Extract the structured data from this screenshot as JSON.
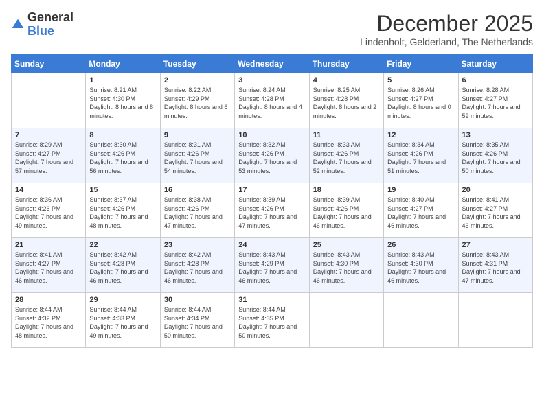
{
  "logo": {
    "general": "General",
    "blue": "Blue"
  },
  "title": "December 2025",
  "location": "Lindenholt, Gelderland, The Netherlands",
  "days_of_week": [
    "Sunday",
    "Monday",
    "Tuesday",
    "Wednesday",
    "Thursday",
    "Friday",
    "Saturday"
  ],
  "weeks": [
    [
      {
        "day": "",
        "sunrise": "",
        "sunset": "",
        "daylight": ""
      },
      {
        "day": "1",
        "sunrise": "Sunrise: 8:21 AM",
        "sunset": "Sunset: 4:30 PM",
        "daylight": "Daylight: 8 hours and 8 minutes."
      },
      {
        "day": "2",
        "sunrise": "Sunrise: 8:22 AM",
        "sunset": "Sunset: 4:29 PM",
        "daylight": "Daylight: 8 hours and 6 minutes."
      },
      {
        "day": "3",
        "sunrise": "Sunrise: 8:24 AM",
        "sunset": "Sunset: 4:28 PM",
        "daylight": "Daylight: 8 hours and 4 minutes."
      },
      {
        "day": "4",
        "sunrise": "Sunrise: 8:25 AM",
        "sunset": "Sunset: 4:28 PM",
        "daylight": "Daylight: 8 hours and 2 minutes."
      },
      {
        "day": "5",
        "sunrise": "Sunrise: 8:26 AM",
        "sunset": "Sunset: 4:27 PM",
        "daylight": "Daylight: 8 hours and 0 minutes."
      },
      {
        "day": "6",
        "sunrise": "Sunrise: 8:28 AM",
        "sunset": "Sunset: 4:27 PM",
        "daylight": "Daylight: 7 hours and 59 minutes."
      }
    ],
    [
      {
        "day": "7",
        "sunrise": "Sunrise: 8:29 AM",
        "sunset": "Sunset: 4:27 PM",
        "daylight": "Daylight: 7 hours and 57 minutes."
      },
      {
        "day": "8",
        "sunrise": "Sunrise: 8:30 AM",
        "sunset": "Sunset: 4:26 PM",
        "daylight": "Daylight: 7 hours and 56 minutes."
      },
      {
        "day": "9",
        "sunrise": "Sunrise: 8:31 AM",
        "sunset": "Sunset: 4:26 PM",
        "daylight": "Daylight: 7 hours and 54 minutes."
      },
      {
        "day": "10",
        "sunrise": "Sunrise: 8:32 AM",
        "sunset": "Sunset: 4:26 PM",
        "daylight": "Daylight: 7 hours and 53 minutes."
      },
      {
        "day": "11",
        "sunrise": "Sunrise: 8:33 AM",
        "sunset": "Sunset: 4:26 PM",
        "daylight": "Daylight: 7 hours and 52 minutes."
      },
      {
        "day": "12",
        "sunrise": "Sunrise: 8:34 AM",
        "sunset": "Sunset: 4:26 PM",
        "daylight": "Daylight: 7 hours and 51 minutes."
      },
      {
        "day": "13",
        "sunrise": "Sunrise: 8:35 AM",
        "sunset": "Sunset: 4:26 PM",
        "daylight": "Daylight: 7 hours and 50 minutes."
      }
    ],
    [
      {
        "day": "14",
        "sunrise": "Sunrise: 8:36 AM",
        "sunset": "Sunset: 4:26 PM",
        "daylight": "Daylight: 7 hours and 49 minutes."
      },
      {
        "day": "15",
        "sunrise": "Sunrise: 8:37 AM",
        "sunset": "Sunset: 4:26 PM",
        "daylight": "Daylight: 7 hours and 48 minutes."
      },
      {
        "day": "16",
        "sunrise": "Sunrise: 8:38 AM",
        "sunset": "Sunset: 4:26 PM",
        "daylight": "Daylight: 7 hours and 47 minutes."
      },
      {
        "day": "17",
        "sunrise": "Sunrise: 8:39 AM",
        "sunset": "Sunset: 4:26 PM",
        "daylight": "Daylight: 7 hours and 47 minutes."
      },
      {
        "day": "18",
        "sunrise": "Sunrise: 8:39 AM",
        "sunset": "Sunset: 4:26 PM",
        "daylight": "Daylight: 7 hours and 46 minutes."
      },
      {
        "day": "19",
        "sunrise": "Sunrise: 8:40 AM",
        "sunset": "Sunset: 4:27 PM",
        "daylight": "Daylight: 7 hours and 46 minutes."
      },
      {
        "day": "20",
        "sunrise": "Sunrise: 8:41 AM",
        "sunset": "Sunset: 4:27 PM",
        "daylight": "Daylight: 7 hours and 46 minutes."
      }
    ],
    [
      {
        "day": "21",
        "sunrise": "Sunrise: 8:41 AM",
        "sunset": "Sunset: 4:27 PM",
        "daylight": "Daylight: 7 hours and 46 minutes."
      },
      {
        "day": "22",
        "sunrise": "Sunrise: 8:42 AM",
        "sunset": "Sunset: 4:28 PM",
        "daylight": "Daylight: 7 hours and 46 minutes."
      },
      {
        "day": "23",
        "sunrise": "Sunrise: 8:42 AM",
        "sunset": "Sunset: 4:28 PM",
        "daylight": "Daylight: 7 hours and 46 minutes."
      },
      {
        "day": "24",
        "sunrise": "Sunrise: 8:43 AM",
        "sunset": "Sunset: 4:29 PM",
        "daylight": "Daylight: 7 hours and 46 minutes."
      },
      {
        "day": "25",
        "sunrise": "Sunrise: 8:43 AM",
        "sunset": "Sunset: 4:30 PM",
        "daylight": "Daylight: 7 hours and 46 minutes."
      },
      {
        "day": "26",
        "sunrise": "Sunrise: 8:43 AM",
        "sunset": "Sunset: 4:30 PM",
        "daylight": "Daylight: 7 hours and 46 minutes."
      },
      {
        "day": "27",
        "sunrise": "Sunrise: 8:43 AM",
        "sunset": "Sunset: 4:31 PM",
        "daylight": "Daylight: 7 hours and 47 minutes."
      }
    ],
    [
      {
        "day": "28",
        "sunrise": "Sunrise: 8:44 AM",
        "sunset": "Sunset: 4:32 PM",
        "daylight": "Daylight: 7 hours and 48 minutes."
      },
      {
        "day": "29",
        "sunrise": "Sunrise: 8:44 AM",
        "sunset": "Sunset: 4:33 PM",
        "daylight": "Daylight: 7 hours and 49 minutes."
      },
      {
        "day": "30",
        "sunrise": "Sunrise: 8:44 AM",
        "sunset": "Sunset: 4:34 PM",
        "daylight": "Daylight: 7 hours and 50 minutes."
      },
      {
        "day": "31",
        "sunrise": "Sunrise: 8:44 AM",
        "sunset": "Sunset: 4:35 PM",
        "daylight": "Daylight: 7 hours and 50 minutes."
      },
      {
        "day": "",
        "sunrise": "",
        "sunset": "",
        "daylight": ""
      },
      {
        "day": "",
        "sunrise": "",
        "sunset": "",
        "daylight": ""
      },
      {
        "day": "",
        "sunrise": "",
        "sunset": "",
        "daylight": ""
      }
    ]
  ]
}
